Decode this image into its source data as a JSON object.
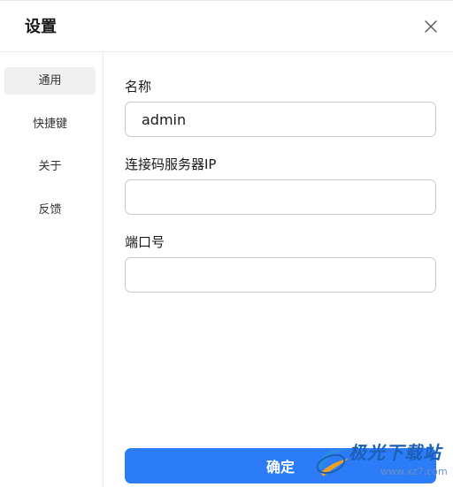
{
  "dialog": {
    "title": "设置"
  },
  "sidebar": {
    "items": [
      {
        "label": "通用",
        "active": true
      },
      {
        "label": "快捷键",
        "active": false
      },
      {
        "label": "关于",
        "active": false
      },
      {
        "label": "反馈",
        "active": false
      }
    ]
  },
  "form": {
    "name": {
      "label": "名称",
      "value": "admin",
      "placeholder": ""
    },
    "server_ip": {
      "label": "连接码服务器IP",
      "value": "",
      "placeholder": ""
    },
    "port": {
      "label": "端口号",
      "value": "",
      "placeholder": ""
    },
    "confirm_label": "确定"
  },
  "watermark": {
    "text": "极光下载站",
    "url": "www.xz7.com"
  },
  "colors": {
    "accent": "#2b7cf6",
    "active_nav_bg": "#f0f0f0",
    "border": "#c9c9c9"
  },
  "icons": {
    "close": "close-icon"
  }
}
